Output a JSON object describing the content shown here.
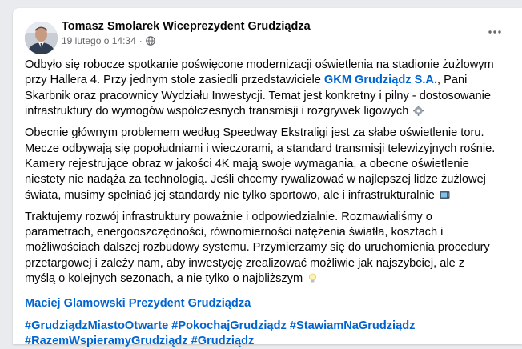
{
  "post": {
    "author": "Tomasz Smolarek Wiceprezydent Grudziądza",
    "date": "19 lutego o 14:34",
    "separator": "·",
    "paragraphs": [
      {
        "before": "Odbyło się robocze spotkanie poświęcone modernizacji oświetlenia na stadionie żużlowym przy Hallera 4. Przy jednym stole zasiedli przedstawiciele ",
        "link": "GKM Grudziądz S.A.",
        "after": ", Pani Skarbnik oraz pracownicy Wydziału Inwestycji. Temat jest konkretny i pilny - dostosowanie infrastruktury do wymogów współczesnych transmisji i rozgrywek ligowych",
        "emoji": "gear-emoji"
      },
      {
        "text": "Obecnie głównym problemem według Speedway Ekstraligi jest za słabe oświetlenie toru. Mecze odbywają się popołudniami i wieczorami, a standard transmisji telewizyjnych rośnie. Kamery rejestrujące obraz w jakości 4K mają swoje wymagania, a obecne oświetlenie niestety nie nadąża za technologią. Jeśli chcemy rywalizować w najlepszej lidze żużlowej świata, musimy spełniać jej standardy nie tylko sportowo, ale i infrastrukturalnie",
        "emoji": "tv-emoji"
      },
      {
        "text": "Traktujemy rozwój infrastruktury poważnie i odpowiedzialnie. Rozmawialiśmy o parametrach, energooszczędności, równomierności natężenia światła, kosztach i możliwościach dalszej rozbudowy systemu. Przymierzamy się do uruchomienia procedury przetargowej i zależy nam, aby inwestycję zrealizować możliwie jak najszybciej, ale z myślą o kolejnych sezonach, a nie tylko o najbliższym",
        "emoji": "lightbulb-emoji"
      }
    ],
    "mention": "Maciej Glamowski Prezydent Grudziądza",
    "hashtags": [
      "#GrudziądzMiastoOtwarte",
      "#PokochajGrudziądz",
      "#StawiamNaGrudziądz",
      "#RazemWspieramyGrudziądz",
      "#Grudziądz"
    ]
  },
  "colors": {
    "link": "#0064d1",
    "text": "#050505",
    "meta": "#65676b",
    "background": "#e9ebee",
    "card": "#ffffff"
  },
  "icons": {
    "avatar": "avatar-photo",
    "privacy": "globe-icon",
    "menu": "more-options-icon"
  }
}
